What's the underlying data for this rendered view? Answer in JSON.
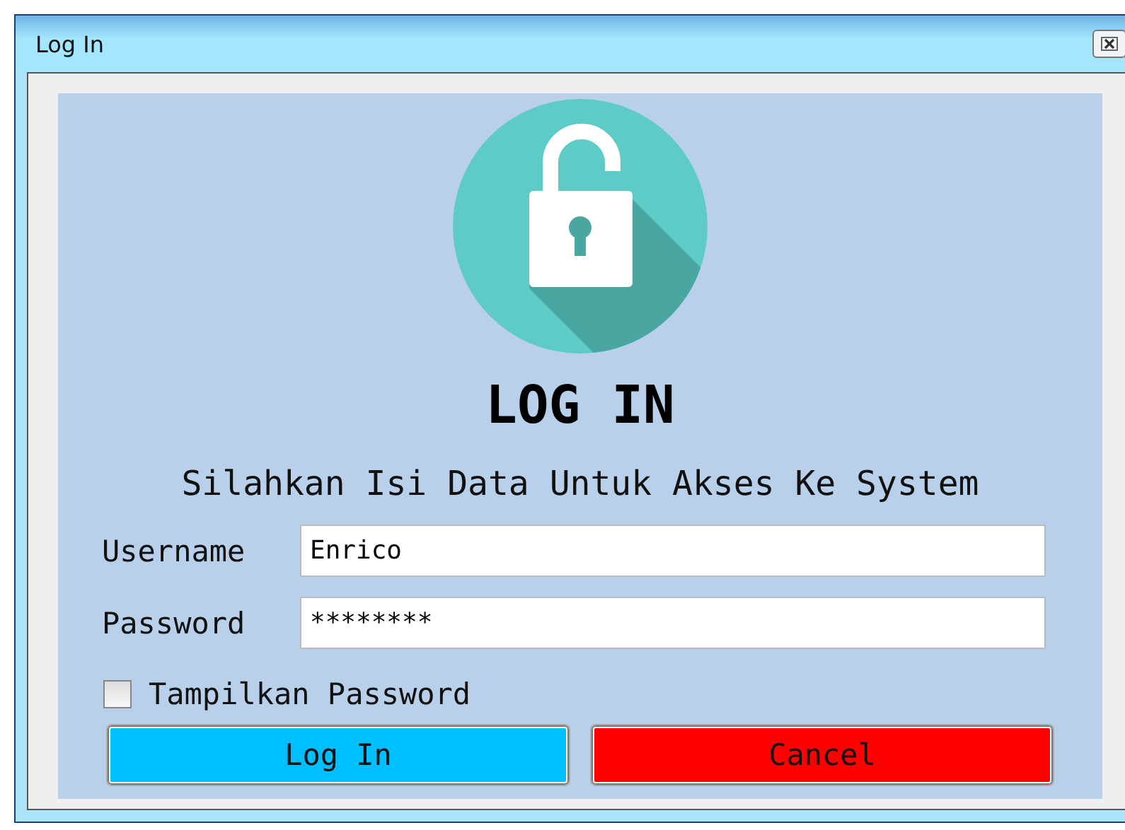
{
  "window": {
    "title": "Log In"
  },
  "heading": "LOG IN",
  "subtitle": "Silahkan Isi Data Untuk Akses Ke System",
  "fields": [
    {
      "label": "Username",
      "value": "Enrico"
    },
    {
      "label": "Password",
      "value": "********"
    }
  ],
  "show_password": {
    "label": "Tampilkan Password",
    "checked": false
  },
  "buttons": [
    {
      "label": "Log In",
      "kind": "primary"
    },
    {
      "label": "Cancel",
      "kind": "danger"
    }
  ]
}
